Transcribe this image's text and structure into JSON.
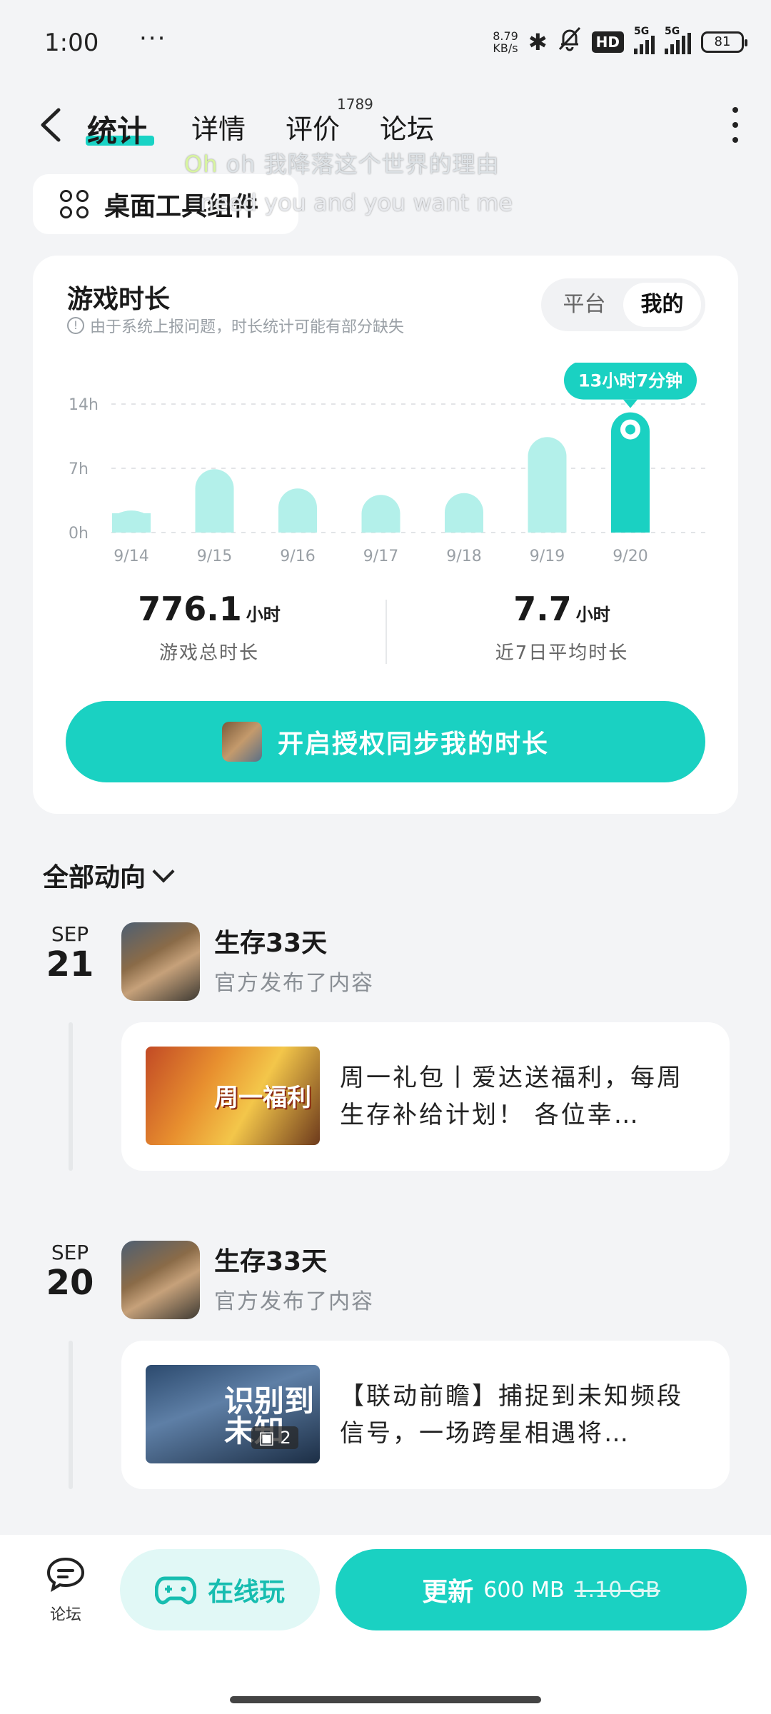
{
  "status": {
    "time": "1:00",
    "more": "···",
    "net_speed_value": "8.79",
    "net_speed_unit": "KB/s",
    "hd": "HD",
    "sig1": "5G",
    "sig2": "5G",
    "battery": "81"
  },
  "nav": {
    "tabs": [
      "统计",
      "详情",
      "评价",
      "论坛"
    ],
    "review_count": "1789"
  },
  "overlay": {
    "lyric_oh": "Oh",
    "lyric_line1": " oh 我降落这个世界的理由",
    "lyric_line2": "need you and you want me"
  },
  "widget_chip": {
    "label": "桌面工具组件"
  },
  "stats": {
    "title": "游戏时长",
    "note": "由于系统上报问题，时长统计可能有部分缺失",
    "segment": [
      "平台",
      "我的"
    ],
    "tooltip": "13小时7分钟",
    "total_value": "776.1",
    "total_unit": "小时",
    "total_label": "游戏总时长",
    "avg_value": "7.7",
    "avg_unit": "小时",
    "avg_label": "近7日平均时长",
    "sync_button": "开启授权同步我的时长"
  },
  "chart_data": {
    "type": "bar",
    "categories": [
      "9/14",
      "9/15",
      "9/16",
      "9/17",
      "9/18",
      "9/19",
      "9/20"
    ],
    "values": [
      2.4,
      6.9,
      4.8,
      4.1,
      4.3,
      10.4,
      13.1
    ],
    "highlight_index": 6,
    "yticks": [
      "14h",
      "7h",
      "0h"
    ],
    "ylim": [
      0,
      14
    ],
    "colors": {
      "bar": "#b3f0ea",
      "highlight": "#1ad1c2"
    }
  },
  "feed": {
    "filter_label": "全部动向",
    "entries": [
      {
        "month": "SEP",
        "day": "21",
        "game": "生存33天",
        "sub": "官方发布了内容",
        "image_text": "周一福利",
        "post_text": "周一礼包丨爱达送福利，每周生存补给计划！ 各位幸…"
      },
      {
        "month": "SEP",
        "day": "20",
        "game": "生存33天",
        "sub": "官方发布了内容",
        "image_text": "识别到未知",
        "image_badge": "2",
        "post_text": "【联动前瞻】捕捉到未知频段信号，一场跨星相遇将…"
      }
    ]
  },
  "bottom": {
    "forum_label": "论坛",
    "play_label": "在线玩",
    "update_label": "更新",
    "update_size": "600 MB",
    "update_old_size": "1.10 GB"
  }
}
